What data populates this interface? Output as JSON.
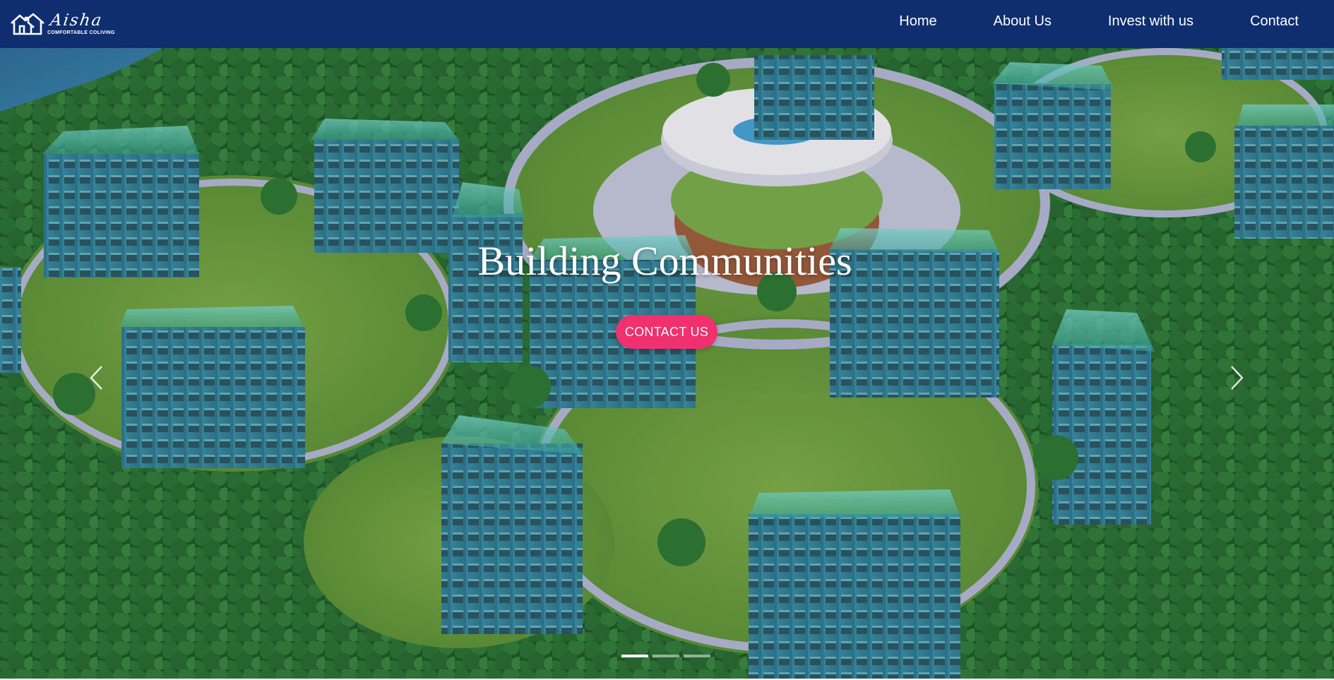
{
  "brand": {
    "name": "Aisha",
    "tagline": "COMFORTABLE COLIVING",
    "logo_icon": "house-icon"
  },
  "nav": {
    "items": [
      {
        "label": "Home"
      },
      {
        "label": "About Us"
      },
      {
        "label": "Invest with us"
      },
      {
        "label": "Contact"
      }
    ]
  },
  "hero": {
    "heading": "Building Communities",
    "cta_label": "CONTACT US",
    "prev_icon": "chevron-left-icon",
    "next_icon": "chevron-right-icon",
    "slides_total": 3,
    "active_slide": 1
  },
  "colors": {
    "navbar": "#0f2e70",
    "cta": "#f0306f",
    "text": "#ffffff"
  }
}
